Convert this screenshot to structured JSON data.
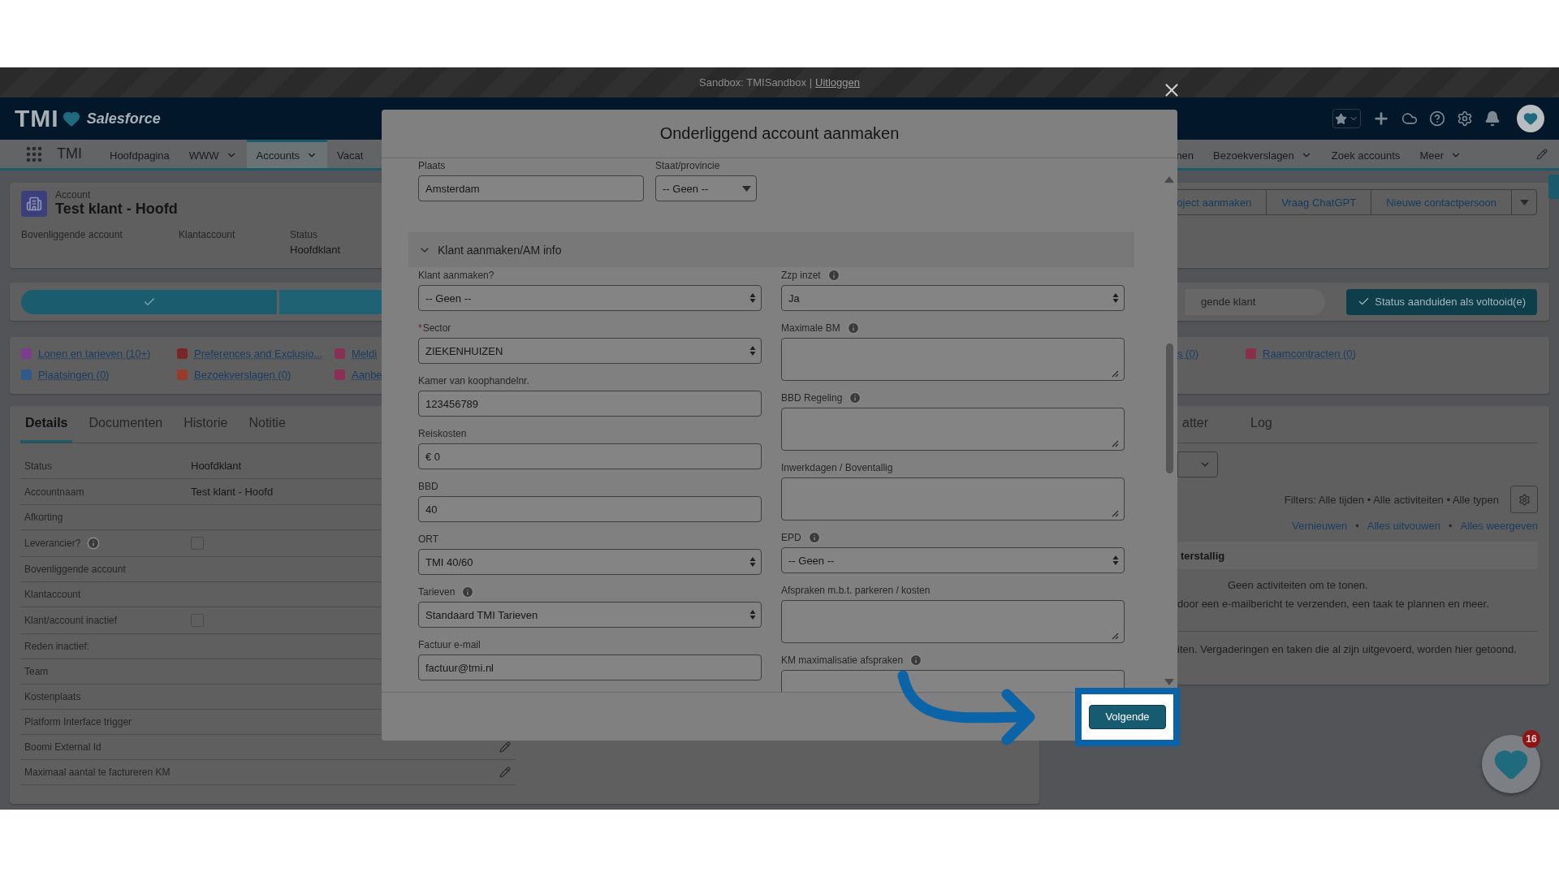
{
  "sandbox_bar": {
    "text": "Sandbox: TMISandbox |",
    "link": "Uitloggen"
  },
  "header": {
    "logo_text": "TMI",
    "brand": "Salesforce"
  },
  "nav": {
    "app_name": "TMI",
    "items": [
      {
        "label": "Hoofdpagina",
        "dropdown": false,
        "selected": false
      },
      {
        "label": "WWW",
        "dropdown": true,
        "selected": false
      },
      {
        "label": "Accounts",
        "dropdown": true,
        "selected": true
      },
      {
        "label": "Vacat",
        "dropdown": false,
        "selected": false
      }
    ],
    "right_items": [
      {
        "label": "nen",
        "dropdown": false,
        "selected": false
      },
      {
        "label": "Bezoekverslagen",
        "dropdown": true,
        "selected": false
      },
      {
        "label": "Zoek accounts",
        "dropdown": false,
        "selected": false
      },
      {
        "label": "Meer",
        "dropdown": true,
        "selected": false
      }
    ]
  },
  "record": {
    "type_label": "Account",
    "name": "Test klant - Hoofd",
    "fields": [
      {
        "label": "Bovenliggende account"
      },
      {
        "label": "Klantaccount"
      },
      {
        "label": "Status",
        "value": "Hoofdklant"
      }
    ],
    "actions": [
      "oject aanmaken",
      "Vraag ChatGPT",
      "Nieuwe contactpersoon"
    ]
  },
  "path": {
    "steps": [
      {
        "kind": "complete"
      },
      {
        "kind": "current"
      }
    ],
    "stage_label": "gende klant",
    "complete_button": "Status aanduiden als voltooid(e)"
  },
  "related": {
    "left": [
      {
        "label": "Lonen en tarieven (10+)",
        "color": "#7b3d8c"
      },
      {
        "label": "Preferences and Exclusio...",
        "color": "#7a2626"
      },
      {
        "label": "Meldi",
        "color": "#8a2f55"
      },
      {
        "label": "Plaatsingen (0)",
        "color": "#2f5b8a"
      },
      {
        "label": "Bezoekverslagen (0)",
        "color": "#9a3a2a"
      },
      {
        "label": "Aanbe",
        "color": "#8a2f55"
      }
    ],
    "right": [
      {
        "label": "s (0)"
      },
      {
        "label": "Raamcontracten (0)",
        "color": "#8a2f4a"
      }
    ]
  },
  "details": {
    "tabs": [
      {
        "label": "Details",
        "selected": true
      },
      {
        "label": "Documenten",
        "selected": false
      },
      {
        "label": "Historie",
        "selected": false
      },
      {
        "label": "Notitie",
        "selected": false
      }
    ],
    "rows": [
      {
        "label": "Status",
        "kind": "text",
        "value": "Hoofdklant"
      },
      {
        "label": "Accountnaam",
        "kind": "text",
        "value": "Test klant - Hoofd"
      },
      {
        "label": "Afkorting",
        "kind": "text"
      },
      {
        "label": "Leverancier?",
        "kind": "checkbox",
        "info": true,
        "checked": false
      },
      {
        "label": "Bovenliggende account",
        "kind": "text"
      },
      {
        "label": "Klantaccount",
        "kind": "text"
      },
      {
        "label": "Klant/account inactief",
        "kind": "checkbox",
        "checked": false
      },
      {
        "label": "Reden inactief:",
        "kind": "text"
      },
      {
        "label": "Team",
        "kind": "text"
      },
      {
        "label": "Kostenplaats",
        "kind": "text"
      },
      {
        "label": "Platform Interface trigger",
        "kind": "text"
      },
      {
        "label": "Boomi External Id",
        "kind": "text",
        "editable": true
      },
      {
        "label": "Maximaal aantal te factureren KM",
        "kind": "text",
        "editable": true
      }
    ]
  },
  "activity": {
    "tabs": [
      {
        "label": "atter",
        "selected": false
      },
      {
        "label": "Log",
        "selected": false
      }
    ],
    "filters": "Filters: Alle tijden • Alle activiteiten • Alle typen",
    "links": [
      "Vernieuwen",
      "Alles uitvouwen",
      "Alles weergeven"
    ],
    "link_separator": "•",
    "section": "terstallig",
    "empty_title": "Geen activiteiten om te tonen.",
    "empty_hint": "door een e-mailbericht te verzenden, een taak te plannen en meer.",
    "past_hint": "iten. Vergaderingen en taken die al zijn uitgevoerd, worden hier getoond."
  },
  "floating_button": {
    "badge": "16"
  },
  "modal": {
    "title": "Onderliggend account aanmaken",
    "top_fields": [
      {
        "label": "Plaats",
        "kind": "input",
        "value": "Amsterdam"
      },
      {
        "label": "Staat/provincie",
        "kind": "dropdown",
        "value": "-- Geen --"
      }
    ],
    "section": {
      "title": "Klant aanmaken/AM info",
      "expanded": true
    },
    "left_fields": [
      {
        "label": "Klant aanmaken?",
        "kind": "select",
        "value": "-- Geen --"
      },
      {
        "label": "Sector",
        "required_mark": "*",
        "kind": "select",
        "value": "ZIEKENHUIZEN"
      },
      {
        "label": "Kamer van koophandelnr.",
        "kind": "input",
        "value": "123456789"
      },
      {
        "label": "Reiskosten",
        "kind": "input",
        "value": "€ 0"
      },
      {
        "label": "BBD",
        "kind": "input",
        "value": "40"
      },
      {
        "label": "ORT",
        "kind": "select",
        "value": "TMI 40/60"
      },
      {
        "label": "Tarieven",
        "info": true,
        "kind": "select",
        "value": "Standaard TMI Tarieven"
      },
      {
        "label": "Factuur e-mail",
        "kind": "input",
        "value": "factuur@tmi.nl"
      }
    ],
    "right_fields": [
      {
        "label": "Zzp inzet",
        "info": true,
        "kind": "select",
        "value": "Ja"
      },
      {
        "label": "Maximale BM",
        "info": true,
        "kind": "textarea"
      },
      {
        "label": "BBD Regeling",
        "info": true,
        "kind": "textarea"
      },
      {
        "label": "Inwerkdagen / Boventallig",
        "kind": "textarea"
      },
      {
        "label": "EPD",
        "info": true,
        "kind": "select",
        "value": "-- Geen --"
      },
      {
        "label": "Afspraken m.b.t. parkeren / kosten",
        "kind": "textarea"
      },
      {
        "label": "KM maximalisatie afspraken",
        "info": true,
        "kind": "textarea",
        "cut": true
      }
    ],
    "footer_button": "Volgende"
  }
}
